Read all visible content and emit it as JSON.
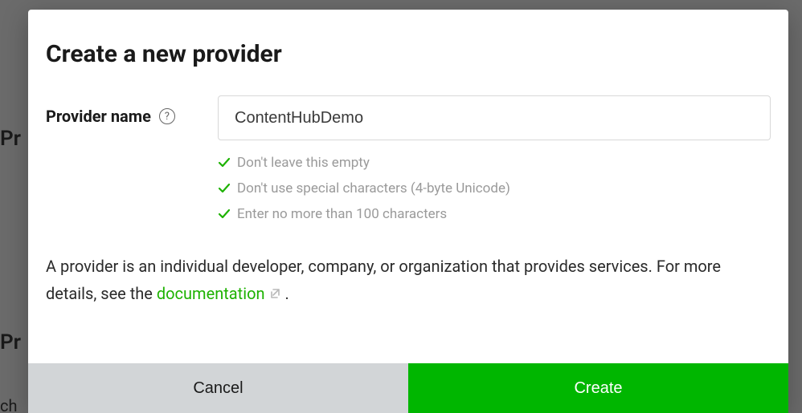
{
  "background": {
    "left1": "Pr",
    "left2": "Pr",
    "left3": "ch"
  },
  "dialog": {
    "title": "Create a new provider",
    "field": {
      "label": "Provider name",
      "value": "ContentHubDemo",
      "help_icon_glyph": "?"
    },
    "validations": [
      {
        "text": "Don't leave this empty"
      },
      {
        "text": "Don't use special characters (4-byte Unicode)"
      },
      {
        "text": "Enter no more than 100 characters"
      }
    ],
    "description": {
      "pre": "A provider is an individual developer, company, or organization that provides services. For more details, see the ",
      "link": "documentation",
      "post": " ."
    },
    "buttons": {
      "cancel": "Cancel",
      "create": "Create"
    }
  }
}
